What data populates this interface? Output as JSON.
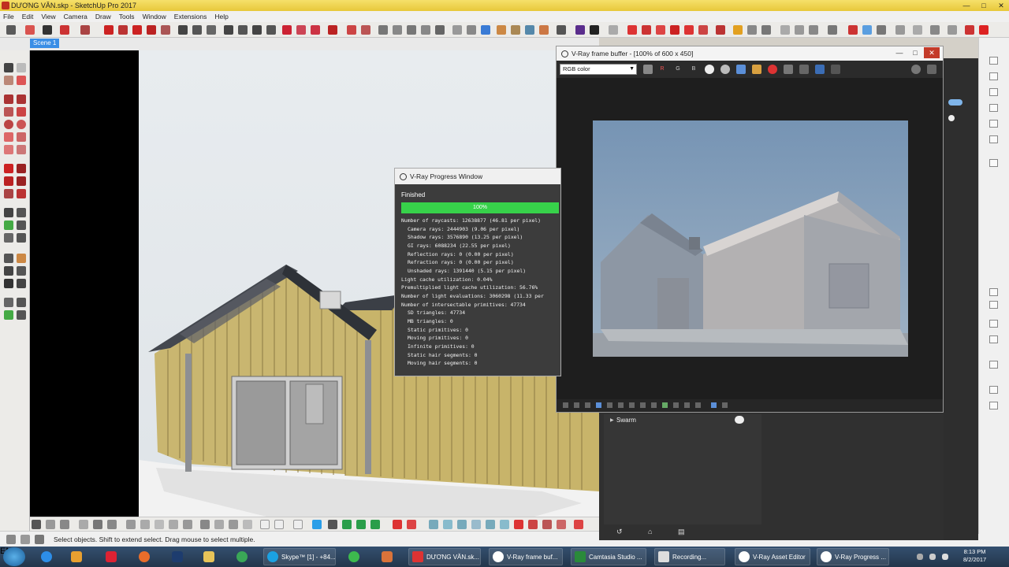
{
  "window": {
    "title": "DƯƠNG VĂN.skp - SketchUp Pro 2017",
    "minimize_glyph": "—",
    "maximize_glyph": "□",
    "close_glyph": "✕"
  },
  "menu": [
    "File",
    "Edit",
    "View",
    "Camera",
    "Draw",
    "Tools",
    "Window",
    "Extensions",
    "Help"
  ],
  "scene_tab": "Scene 1",
  "status_message": "Select objects. Shift to extend select. Drag mouse to select multiple.",
  "progress_window": {
    "title": "V-Ray Progress Window",
    "status": "Finished",
    "progress_label": "100%",
    "progress_percent": 100,
    "progress_color": "#37d24a",
    "stats": [
      {
        "text": "Number of raycasts: 12638877 (46.81 per pixel)",
        "indent": false
      },
      {
        "text": "Camera rays: 2444903 (9.06 per pixel)",
        "indent": true
      },
      {
        "text": "Shadow rays: 3576890 (13.25 per pixel)",
        "indent": true
      },
      {
        "text": "GI rays: 6088234 (22.55 per pixel)",
        "indent": true
      },
      {
        "text": "Reflection rays: 0 (0.00 per pixel)",
        "indent": true
      },
      {
        "text": "Refraction rays: 0 (0.00 per pixel)",
        "indent": true
      },
      {
        "text": "Unshaded rays: 1391440 (5.15 per pixel)",
        "indent": true
      },
      {
        "text": "Light cache utilization: 0.04%",
        "indent": false
      },
      {
        "text": "Premultiplied light cache utilization: 56.76%",
        "indent": false
      },
      {
        "text": "Number of light evaluations: 3060298 (11.33 per",
        "indent": false
      },
      {
        "text": "Number of intersectable primitives: 47734",
        "indent": false
      },
      {
        "text": "SD triangles: 47734",
        "indent": true
      },
      {
        "text": "MB triangles: 0",
        "indent": true
      },
      {
        "text": "Static primitives: 0",
        "indent": true
      },
      {
        "text": "Moving primitives: 0",
        "indent": true
      },
      {
        "text": "Infinite primitives: 0",
        "indent": true
      },
      {
        "text": "Static hair segments: 0",
        "indent": true
      },
      {
        "text": "Moving hair segments: 0",
        "indent": true
      }
    ]
  },
  "frame_buffer": {
    "title": "V-Ray frame buffer - [100% of 600 x 450]",
    "channel": "RGB color",
    "channel_buttons": [
      "R",
      "G",
      "B"
    ]
  },
  "asset_panel": {
    "swarm_label": "Swarm"
  },
  "taskbar": {
    "tasks": [
      "Skype™ [1] - +84...",
      "DƯƠNG VĂN.sk...",
      "V-Ray frame buf...",
      "Camtasia Studio ...",
      "Recording...",
      "V-Ray Asset Editor",
      "V-Ray Progress ..."
    ],
    "language": "EN",
    "time": "8:13 PM",
    "date": "8/2/2017"
  }
}
